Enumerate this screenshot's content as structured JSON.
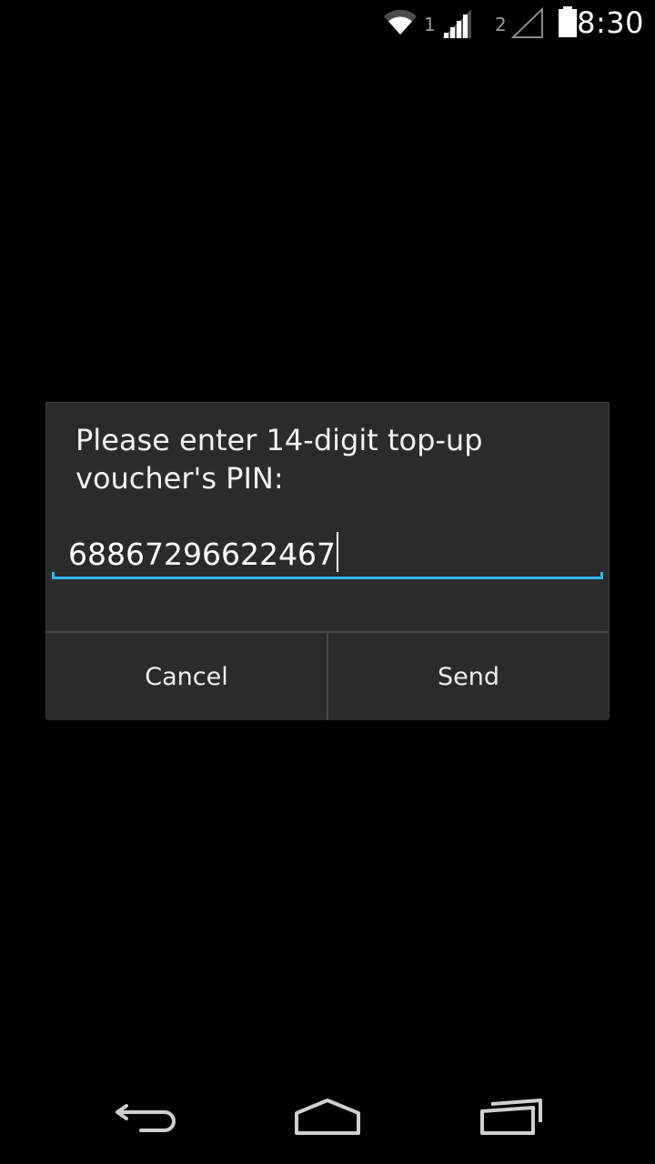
{
  "status_bar": {
    "time": "8:30",
    "sim1_label": "1",
    "sim2_label": "2",
    "icons": [
      "wifi-icon",
      "signal-sim1-icon",
      "signal-sim2-icon",
      "battery-icon"
    ]
  },
  "dialog": {
    "message": "Please enter 14-digit top-up voucher's PIN:",
    "pin_value": "68867296622467",
    "cancel_label": "Cancel",
    "send_label": "Send"
  },
  "nav_bar": {
    "icons": [
      "back-icon",
      "home-icon",
      "recent-apps-icon"
    ]
  },
  "colors": {
    "background": "#000000",
    "dialog_bg": "#2b2b2b",
    "accent": "#33b5e5",
    "text": "#ffffff"
  }
}
